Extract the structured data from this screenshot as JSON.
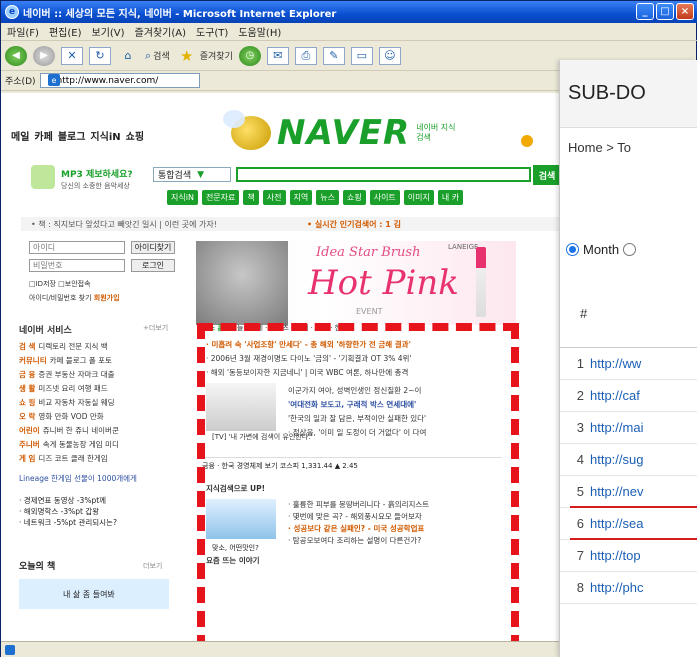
{
  "browser": {
    "title": "네이버 :: 세상의 모든 지식, 네이버 - Microsoft Internet Explorer",
    "menu": [
      "파일(F)",
      "편집(E)",
      "보기(V)",
      "즐겨찾기(A)",
      "도구(T)",
      "도움말(H)"
    ],
    "toolbar": {
      "search_label": "검색",
      "favorites_label": "즐겨찾기"
    },
    "address_label": "주소(D)",
    "address_value": "http://www.naver.com/",
    "window_buttons": [
      "_",
      "□",
      "×"
    ]
  },
  "naver": {
    "top_links": [
      "메일",
      "카페",
      "블로그",
      "지식iN",
      "쇼핑"
    ],
    "logo_text": "NAVER",
    "logo_sub": "네이버 지식검색",
    "mp3_title": "MP3 제보하세요?",
    "mp3_sub": "당신의 소중한 음악세상",
    "search_select": "통합검색",
    "search_button": "검색",
    "search_tabs": [
      "지식iN",
      "전문자료",
      "책",
      "사전",
      "지역",
      "뉴스",
      "쇼핑",
      "사이트",
      "이미지",
      "내 카"
    ],
    "notice": "• 책 : 직지보다 앞섰다고 빼앗긴 일시 | 이런 곳에 가자!",
    "realtime": "• 실시간 인기검색어 : 1 김",
    "login": {
      "id_placeholder": "아이디",
      "pw_placeholder": "비밀번호",
      "join": "아이디찾기",
      "login_button": "로그인",
      "options": "□ID저장 □보안접속",
      "links": "아이디/비밀번호 찾기",
      "links_hl": "회원가입"
    },
    "banner": {
      "pre": "Idea Star Brush",
      "main": "Hot Pink",
      "event": "EVENT",
      "lan": "LANEIGE"
    },
    "sidebar": {
      "title": "네이버 서비스",
      "more": "+더보기",
      "items": [
        {
          "key": "검 색",
          "text": "디렉토리 전문 지식 백"
        },
        {
          "key": "커뮤니티",
          "text": "카페 블로그 폴 포토"
        },
        {
          "key": "금 융",
          "text": "증권 부동산 자마크 대출"
        },
        {
          "key": "생 활",
          "text": "미즈넷 요리 여행 패드"
        },
        {
          "key": "쇼 핑",
          "text": "비교 자동차 자동실 웨딩"
        },
        {
          "key": "오 락",
          "text": "영화 만화 VOD 만화"
        },
        {
          "key": "어린이",
          "text": "쥬니버 한 쥬니 네이버쿤"
        },
        {
          "key": "주니버",
          "text": "속게 동물농장 게임 미디"
        },
        {
          "key": "게 임",
          "text": "디즈 코트 클래 한게임"
        }
      ],
      "promo": "Lineage 한게임 선물이 1000개에게",
      "green_lines": [
        "· 경제연표 동영상 -3%pt께",
        "· 해외명학스 -3%pt 갑왕",
        "· 네트워크 -5%pt 관리되시는?"
      ],
      "book_title": "오늘의 책",
      "book_more": "더보기",
      "book_text": "내 삶 좀 들여봐"
    },
    "news": {
      "tabs_lead": "뉴스 홈",
      "tabs": "· 오늘 · 국제 · 스포츠 · 연예 · 일반 · 한국증",
      "headline": "· 미흡려 속 '사업조항' 만세다' - 총 해외 '하향한가 전 금해 결과'",
      "line2": "· 2006년 3월 재경이명도 다이노 '금의' - '기획결과 OT 3% 4위'",
      "line3": "· 해외 '동등보이자한 지금네니' | 미국 WBC 여론, 하나만에 총격",
      "side1": "이군가지 여아, 성벽인생인 정신질환 2~이",
      "side2": "'여대전화 보도고, 구래적 박스 연세대에'",
      "side3": "'한국의 일과 잘 담은, 부적이만 실패한 있다'",
      "side4": "· 정상을, '이미 일 도정이 더 거없다' 이 다여",
      "img_caption": "[TV] '내 가변에\n검색이 유인한다.'",
      "stock": "금융 · 한국 경영체제 보기   코스피 1,331.44 ▲ 2.45",
      "section2": "지식검색으로 UP!",
      "section2_lines": [
        "· 훌륭한 피부를 몽땅버리니다 - 흙의리지스트",
        "· 몇번에 맞은 곡? - 해외풍시요모 들어보자",
        "· 성공보다 같은 실패인? - 미국 성공학업표",
        "· 탐공모보여다 조리하는 설명이 다른건가?"
      ],
      "section2_caption": "맞소, 어떤맛인?",
      "section3": "요즘 뜨는 이야기"
    }
  },
  "overlay": {
    "title": "SUB-DO",
    "breadcrumb": "Home > To",
    "radio_month": "Month",
    "hash": "#",
    "rows": [
      {
        "num": "1",
        "url": "http://ww"
      },
      {
        "num": "2",
        "url": "http://caf"
      },
      {
        "num": "3",
        "url": "http://mai"
      },
      {
        "num": "4",
        "url": "http://sug"
      },
      {
        "num": "5",
        "url": "http://nev"
      },
      {
        "num": "6",
        "url": "http://sea"
      },
      {
        "num": "7",
        "url": "http://top"
      },
      {
        "num": "8",
        "url": "http://phc"
      }
    ]
  }
}
